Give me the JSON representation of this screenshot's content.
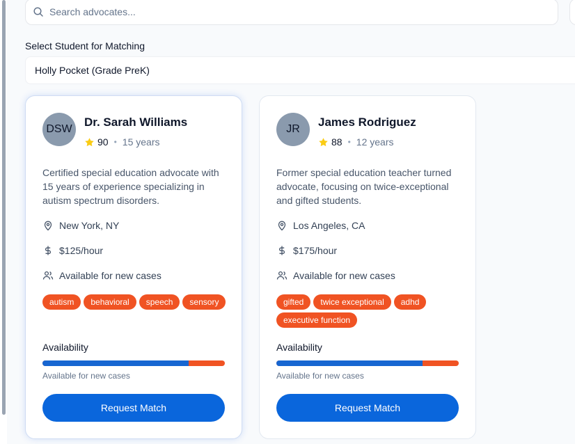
{
  "search": {
    "placeholder": "Search advocates...",
    "value": ""
  },
  "student_select": {
    "label": "Select Student for Matching",
    "selected": "Holly Pocket (Grade PreK)"
  },
  "colors": {
    "primary": "#0a66dc",
    "tag": "#f05323",
    "star": "#facc15",
    "avatar": "#8a9aad"
  },
  "advocates": [
    {
      "initials": "DSW",
      "name": "Dr. Sarah Williams",
      "rating": "90",
      "experience": "15 years",
      "description": "Certified special education advocate with 15 years of experience specializing in autism spectrum disorders.",
      "location": "New York, NY",
      "rate": "$125/hour",
      "status": "Available for new cases",
      "tags": [
        "autism",
        "behavioral",
        "speech",
        "sensory"
      ],
      "availability_title": "Availability",
      "availability_fraction": 0.8,
      "availability_text": "Available for new cases",
      "button_label": "Request Match"
    },
    {
      "initials": "JR",
      "name": "James Rodriguez",
      "rating": "88",
      "experience": "12 years",
      "description": "Former special education teacher turned advocate, focusing on twice-exceptional and gifted students.",
      "location": "Los Angeles, CA",
      "rate": "$175/hour",
      "status": "Available for new cases",
      "tags": [
        "gifted",
        "twice exceptional",
        "adhd",
        "executive function"
      ],
      "availability_title": "Availability",
      "availability_fraction": 0.8,
      "availability_text": "Available for new cases",
      "button_label": "Request Match"
    }
  ]
}
